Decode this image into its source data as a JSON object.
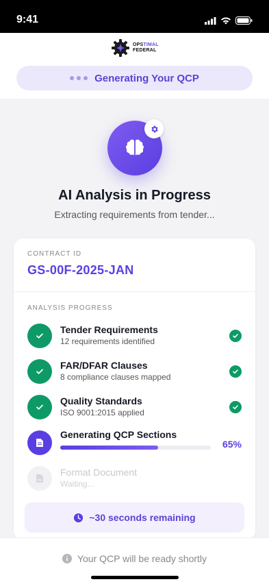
{
  "status_bar": {
    "time": "9:41"
  },
  "logo": {
    "line1_a": "OPS",
    "line1_b": "TIMAL",
    "line2": "FEDERAL"
  },
  "banner": {
    "label": "Generating Your QCP"
  },
  "hero": {
    "title": "AI Analysis in Progress",
    "subtitle": "Extracting requirements from tender..."
  },
  "contract": {
    "label": "CONTRACT ID",
    "value": "GS-00F-2025-JAN"
  },
  "progress": {
    "label": "ANALYSIS PROGRESS",
    "steps": [
      {
        "title": "Tender Requirements",
        "subtitle": "12 requirements identified",
        "state": "done"
      },
      {
        "title": "FAR/DFAR Clauses",
        "subtitle": "8 compliance clauses mapped",
        "state": "done"
      },
      {
        "title": "Quality Standards",
        "subtitle": "ISO 9001:2015 applied",
        "state": "done"
      },
      {
        "title": "Generating QCP Sections",
        "percent_label": "65%",
        "percent": 65,
        "state": "active"
      },
      {
        "title": "Format Document",
        "subtitle": "Waiting...",
        "state": "pending"
      }
    ]
  },
  "remaining": {
    "label": "~30 seconds remaining"
  },
  "footer": {
    "message": "Your QCP will be ready shortly"
  },
  "colors": {
    "accent": "#5b3ee2",
    "success": "#0e9a66"
  }
}
